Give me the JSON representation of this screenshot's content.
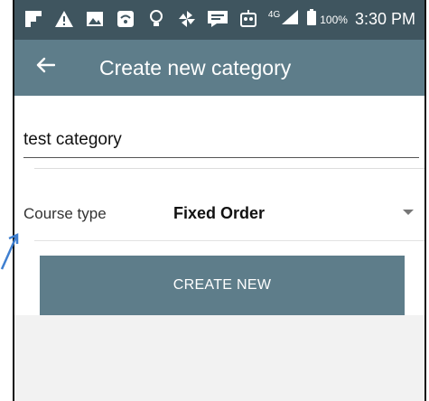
{
  "status_bar": {
    "network": "4G",
    "battery": "100%",
    "time": "3:30 PM"
  },
  "app_bar": {
    "title": "Create new category"
  },
  "form": {
    "name_value": "test category",
    "course_type_label": "Course type",
    "course_type_value": "Fixed Order",
    "create_button_label": "CREATE NEW"
  },
  "colors": {
    "status_bar": "#3f555f",
    "app_bar": "#5e7d8a",
    "button": "#5e7d8a",
    "pointer": "#3f7fd0"
  },
  "icons": {
    "back": "arrow-left-icon",
    "dropdown": "chevron-down-icon"
  }
}
